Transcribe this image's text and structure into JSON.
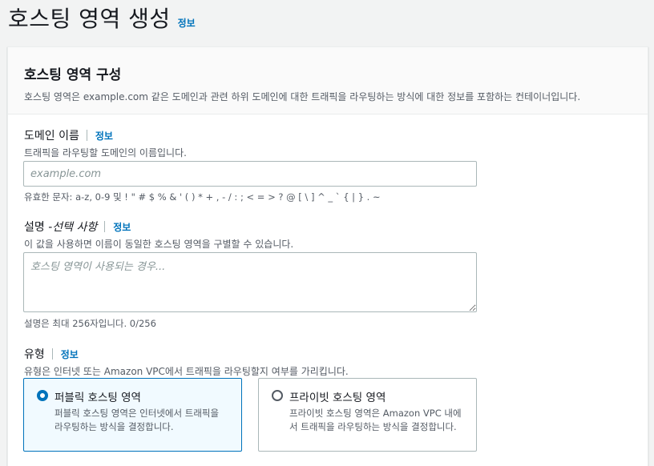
{
  "page": {
    "title": "호스팅 영역 생성",
    "info_link": "정보"
  },
  "panel": {
    "title": "호스팅 영역 구성",
    "description": "호스팅 영역은 example.com 같은 도메인과 관련 하위 도메인에 대한 트래픽을 라우팅하는 방식에 대한 정보를 포함하는 컨테이너입니다."
  },
  "domain_name": {
    "label": "도메인 이름",
    "info_link": "정보",
    "description": "트래픽을 라우팅할 도메인의 이름입니다.",
    "placeholder": "example.com",
    "value": "",
    "constraint": "유효한 문자: a-z, 0-9 및 ! \" # $ % & ' ( ) * + , - / : ; < = > ? @ [ \\ ] ^ _ ` { | } . ~"
  },
  "description_field": {
    "label": "설명 - ",
    "label_optional": "선택 사항",
    "info_link": "정보",
    "description": "이 값을 사용하면 이름이 동일한 호스팅 영역을 구별할 수 있습니다.",
    "placeholder": "호스팅 영역이 사용되는 경우...",
    "value": "",
    "constraint": "설명은 최대 256자입니다. 0/256"
  },
  "type_field": {
    "label": "유형",
    "info_link": "정보",
    "description": "유형은 인터넷 또는 Amazon VPC에서 트래픽을 라우팅할지 여부를 가리킵니다.",
    "options": [
      {
        "title": "퍼블릭 호스팅 영역",
        "description": "퍼블릭 호스팅 영역은 인터넷에서 트래픽을 라우팅하는 방식을 결정합니다.",
        "selected": true
      },
      {
        "title": "프라이빗 호스팅 영역",
        "description": "프라이빗 호스팅 영역은 Amazon VPC 내에서 트래픽을 라우팅하는 방식을 결정합니다.",
        "selected": false
      }
    ]
  }
}
